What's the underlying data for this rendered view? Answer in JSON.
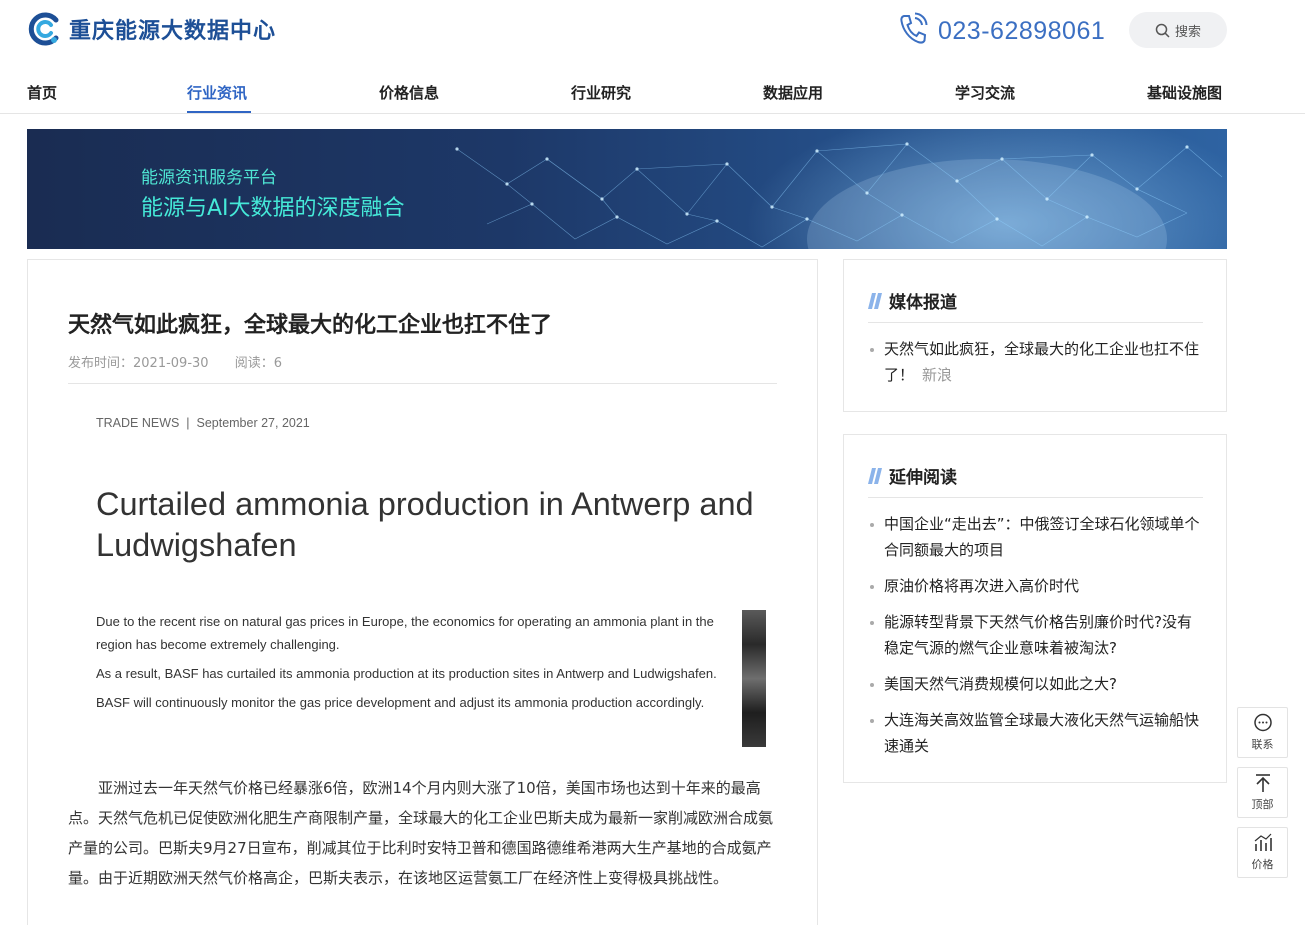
{
  "header": {
    "site_name": "重庆能源大数据中心",
    "phone": "023-62898061",
    "search_label": "搜索"
  },
  "nav": {
    "items": [
      {
        "label": "首页"
      },
      {
        "label": "行业资讯",
        "active": true
      },
      {
        "label": "价格信息"
      },
      {
        "label": "行业研究"
      },
      {
        "label": "数据应用"
      },
      {
        "label": "学习交流"
      },
      {
        "label": "基础设施图"
      }
    ],
    "accent_color": "#2f65c4"
  },
  "banner": {
    "subtitle": "能源资讯服务平台",
    "title": "能源与AI大数据的深度融合"
  },
  "article": {
    "title": "天然气如此疯狂，全球最大的化工企业也扛不住了",
    "publish_label": "发布时间：",
    "publish_date": "2021-09-30",
    "read_label": "阅读：",
    "read_count": "6",
    "image": {
      "kicker": "TRADE NEWS  |  September 27, 2021",
      "headline": "Curtailed ammonia production in Antwerp and Ludwigshafen",
      "paragraphs": [
        "Due to the recent rise on natural gas prices in Europe, the economics for operating an ammonia plant in the region has become extremely challenging.",
        "As a result, BASF has curtailed its ammonia production at its production sites in Antwerp and Ludwigshafen.",
        "BASF will continuously monitor the gas price development and adjust its ammonia production accordingly."
      ]
    },
    "body": "亚洲过去一年天然气价格已经暴涨6倍，欧洲14个月内则大涨了10倍，美国市场也达到十年来的最高点。天然气危机已促使欧洲化肥生产商限制产量，全球最大的化工企业巴斯夫成为最新一家削减欧洲合成氨产量的公司。巴斯夫9月27日宣布，削减其位于比利时安特卫普和德国路德维希港两大生产基地的合成氨产量。由于近期欧洲天然气价格高企，巴斯夫表示，在该地区运营氨工厂在经济性上变得极具挑战性。"
  },
  "sidebar": {
    "media": {
      "heading": "媒体报道",
      "items": [
        {
          "title": "天然气如此疯狂，全球最大的化工企业也扛不住了！",
          "source": "新浪"
        }
      ]
    },
    "related": {
      "heading": "延伸阅读",
      "items": [
        {
          "title": "中国企业“走出去”：中俄签订全球石化领域单个合同额最大的项目"
        },
        {
          "title": "原油价格将再次进入高价时代"
        },
        {
          "title": "能源转型背景下天然气价格告别廉价时代?没有稳定气源的燃气企业意味着被淘汰?"
        },
        {
          "title": "美国天然气消费规模何以如此之大?"
        },
        {
          "title": "大连海关高效监管全球最大液化天然气运输船快速通关"
        }
      ]
    }
  },
  "tools": {
    "contact": "联系",
    "top": "顶部",
    "price": "价格"
  }
}
